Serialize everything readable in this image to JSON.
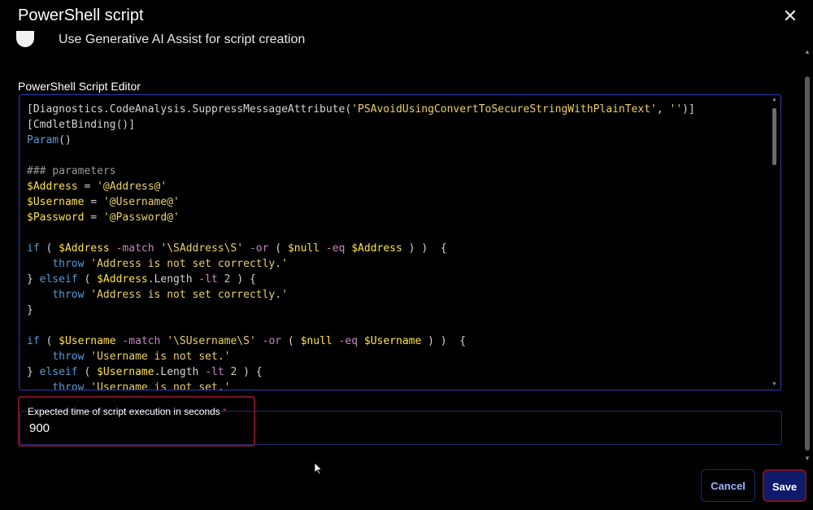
{
  "dialog": {
    "title": "PowerShell script",
    "close_icon": "✕"
  },
  "ai_assist": {
    "label": "Use Generative AI Assist for script creation"
  },
  "editor": {
    "label": "PowerShell Script Editor",
    "lines": [
      [
        [
          "plain",
          "[Diagnostics.CodeAnalysis.SuppressMessageAttribute("
        ],
        [
          "str",
          "'PSAvoidUsingConvertToSecureStringWithPlainText'"
        ],
        [
          "plain",
          ", "
        ],
        [
          "str",
          "''"
        ],
        [
          "plain",
          ")]"
        ]
      ],
      [
        [
          "plain",
          "[CmdletBinding()]"
        ]
      ],
      [
        [
          "kw",
          "Param"
        ],
        [
          "plain",
          "()"
        ]
      ],
      [
        [
          "plain",
          ""
        ]
      ],
      [
        [
          "cmt",
          "### parameters"
        ]
      ],
      [
        [
          "var",
          "$Address"
        ],
        [
          "plain",
          " = "
        ],
        [
          "str",
          "'@Address@'"
        ]
      ],
      [
        [
          "var",
          "$Username"
        ],
        [
          "plain",
          " = "
        ],
        [
          "str",
          "'@Username@'"
        ]
      ],
      [
        [
          "var",
          "$Password"
        ],
        [
          "plain",
          " = "
        ],
        [
          "str",
          "'@Password@'"
        ]
      ],
      [
        [
          "plain",
          ""
        ]
      ],
      [
        [
          "kw",
          "if"
        ],
        [
          "plain",
          " ( "
        ],
        [
          "var",
          "$Address"
        ],
        [
          "op",
          " -match "
        ],
        [
          "str",
          "'\\SAddress\\S'"
        ],
        [
          "op",
          " -or"
        ],
        [
          "plain",
          " ( "
        ],
        [
          "var",
          "$null"
        ],
        [
          "op",
          " -eq "
        ],
        [
          "var",
          "$Address"
        ],
        [
          "plain",
          " ) )  {"
        ]
      ],
      [
        [
          "plain",
          "    "
        ],
        [
          "kw",
          "throw"
        ],
        [
          "plain",
          " "
        ],
        [
          "str",
          "'Address is not set correctly.'"
        ]
      ],
      [
        [
          "plain",
          "} "
        ],
        [
          "kw",
          "elseif"
        ],
        [
          "plain",
          " ( "
        ],
        [
          "var",
          "$Address"
        ],
        [
          "plain",
          ".Length "
        ],
        [
          "op",
          "-lt"
        ],
        [
          "plain",
          " "
        ],
        [
          "num",
          "2"
        ],
        [
          "plain",
          " ) {"
        ]
      ],
      [
        [
          "plain",
          "    "
        ],
        [
          "kw",
          "throw"
        ],
        [
          "plain",
          " "
        ],
        [
          "str",
          "'Address is not set correctly.'"
        ]
      ],
      [
        [
          "plain",
          "}"
        ]
      ],
      [
        [
          "plain",
          ""
        ]
      ],
      [
        [
          "kw",
          "if"
        ],
        [
          "plain",
          " ( "
        ],
        [
          "var",
          "$Username"
        ],
        [
          "op",
          " -match "
        ],
        [
          "str",
          "'\\SUsername\\S'"
        ],
        [
          "op",
          " -or"
        ],
        [
          "plain",
          " ( "
        ],
        [
          "var",
          "$null"
        ],
        [
          "op",
          " -eq "
        ],
        [
          "var",
          "$Username"
        ],
        [
          "plain",
          " ) )  {"
        ]
      ],
      [
        [
          "plain",
          "    "
        ],
        [
          "kw",
          "throw"
        ],
        [
          "plain",
          " "
        ],
        [
          "str",
          "'Username is not set.'"
        ]
      ],
      [
        [
          "plain",
          "} "
        ],
        [
          "kw",
          "elseif"
        ],
        [
          "plain",
          " ( "
        ],
        [
          "var",
          "$Username"
        ],
        [
          "plain",
          ".Length "
        ],
        [
          "op",
          "-lt"
        ],
        [
          "plain",
          " "
        ],
        [
          "num",
          "2"
        ],
        [
          "plain",
          " ) {"
        ]
      ],
      [
        [
          "plain",
          "    "
        ],
        [
          "kw",
          "throw"
        ],
        [
          "plain",
          " "
        ],
        [
          "str",
          "'Username is not set.'"
        ]
      ]
    ]
  },
  "execution_time": {
    "label": "Expected time of script execution in seconds",
    "required_mark": "*",
    "value": "900"
  },
  "buttons": {
    "cancel": "Cancel",
    "save": "Save"
  },
  "colors": {
    "keyword": "#569cd6",
    "variable": "#ffe14d",
    "string": "#e8d16a",
    "save_bg": "#0f1a6b",
    "highlight": "#7a1222"
  }
}
